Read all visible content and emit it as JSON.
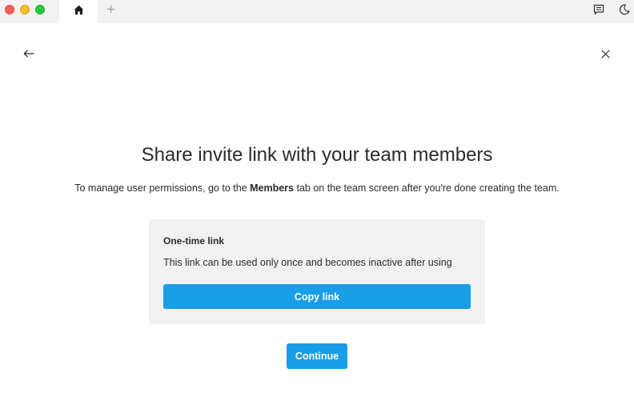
{
  "titlebar": {
    "tabs": [
      {
        "icon": "home-icon",
        "active": true
      }
    ],
    "new_tab_icon": "plus-icon",
    "right_icons": [
      "feedback-icon",
      "moon-icon"
    ],
    "colors": {
      "background": "#f2f2f2",
      "active_tab": "#ffffff"
    }
  },
  "nav": {
    "back_icon": "arrow-left-icon",
    "close_icon": "close-icon"
  },
  "main": {
    "title": "Share invite link with your team members",
    "subtitle_before": "To manage user permissions, go to the ",
    "subtitle_bold": "Members",
    "subtitle_after": " tab on the team screen after you're done creating the team.",
    "card": {
      "title": "One-time link",
      "description": "This link can be used only once and becomes inactive after using",
      "copy_button_label": "Copy link"
    },
    "continue_button_label": "Continue"
  },
  "colors": {
    "accent": "#189ee6",
    "card_background": "#f1f1f1"
  }
}
